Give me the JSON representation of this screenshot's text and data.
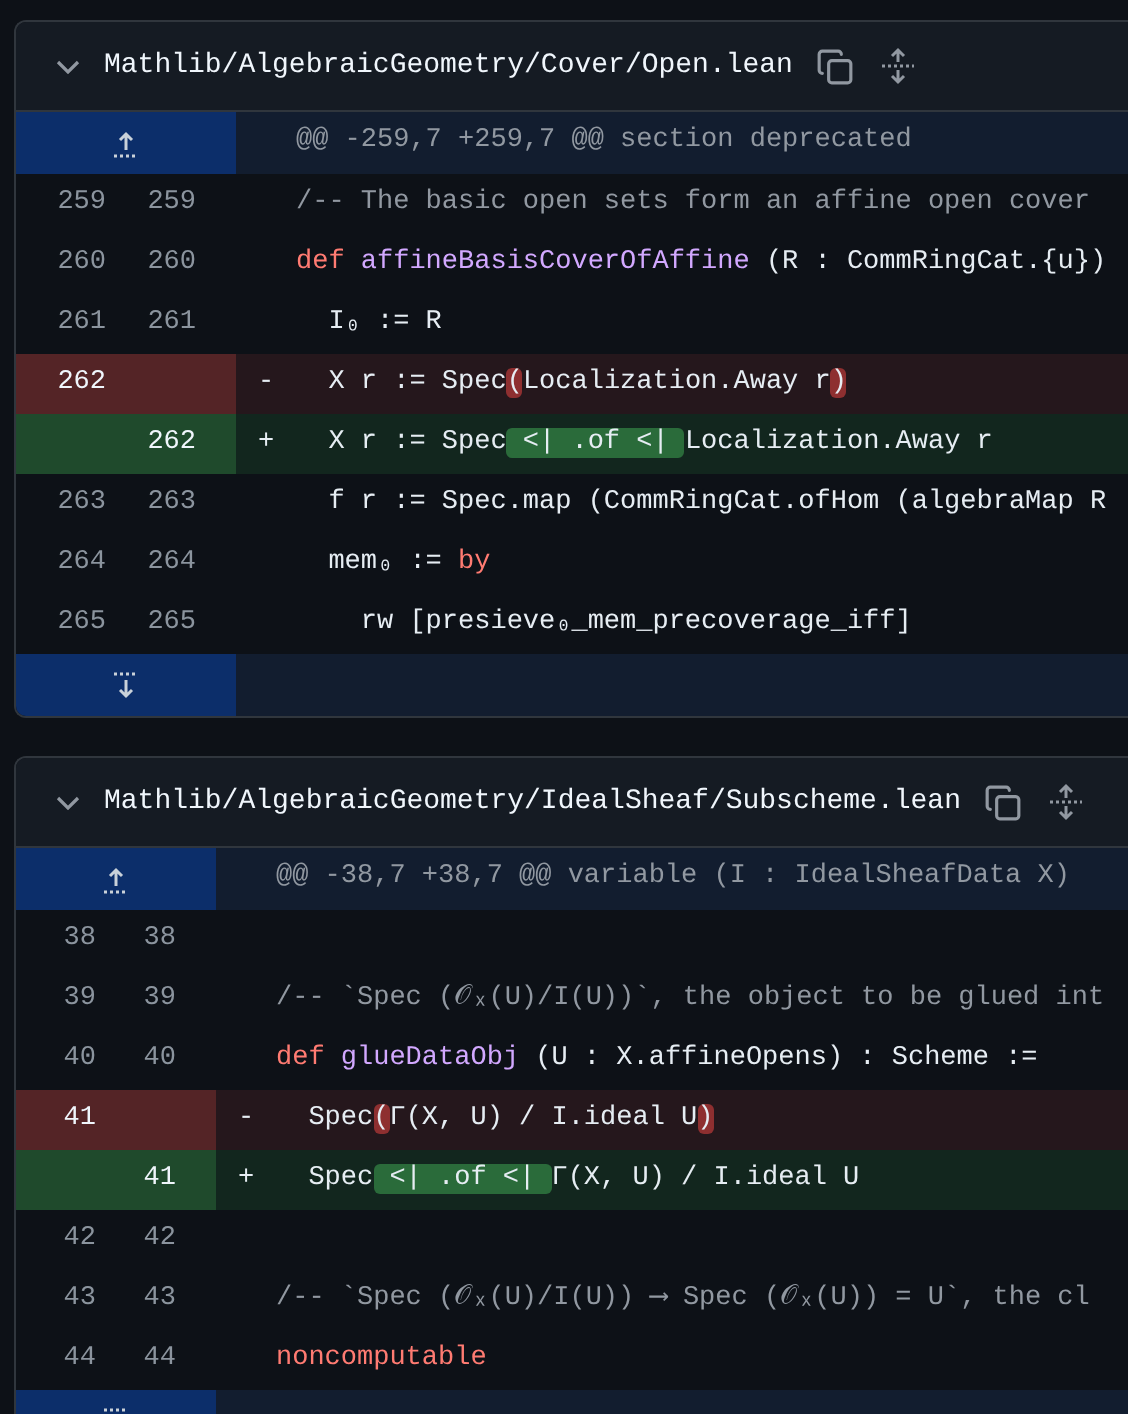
{
  "files": [
    {
      "path": "Mathlib/AlgebraicGeometry/Cover/Open.lean",
      "expanded": true,
      "hunk_header": "@@ -259,7 +259,7 @@ section deprecated",
      "bottom_expander": true,
      "lines": [
        {
          "kind": "context",
          "old": "259",
          "new": "259",
          "segments": [
            {
              "kind": "comment",
              "text": "/-- The basic open sets form an affine open cover"
            }
          ]
        },
        {
          "kind": "context",
          "old": "260",
          "new": "260",
          "segments": [
            {
              "kind": "keyword",
              "text": "def "
            },
            {
              "kind": "name",
              "text": "affineBasisCoverOfAffine"
            },
            {
              "kind": "plain",
              "text": " (R : CommRingCat.{u})"
            }
          ]
        },
        {
          "kind": "context",
          "old": "261",
          "new": "261",
          "segments": [
            {
              "kind": "plain",
              "text": "  I₀ := R"
            }
          ]
        },
        {
          "kind": "deleted",
          "old": "262",
          "sign": "-",
          "segments": [
            {
              "kind": "plain",
              "text": "  X r := Spec"
            },
            {
              "kind": "deleted_mark",
              "text": "("
            },
            {
              "kind": "plain",
              "text": "Localization.Away r"
            },
            {
              "kind": "deleted_mark",
              "text": ")"
            }
          ]
        },
        {
          "kind": "added",
          "new": "262",
          "sign": "+",
          "segments": [
            {
              "kind": "plain",
              "text": "  X r := Spec"
            },
            {
              "kind": "added_mark",
              "text": " <| .of <| "
            },
            {
              "kind": "plain",
              "text": "Localization.Away r"
            }
          ]
        },
        {
          "kind": "context",
          "old": "263",
          "new": "263",
          "segments": [
            {
              "kind": "plain",
              "text": "  f r := Spec.map (CommRingCat.ofHom (algebraMap R"
            }
          ]
        },
        {
          "kind": "context",
          "old": "264",
          "new": "264",
          "segments": [
            {
              "kind": "plain",
              "text": "  mem₀ := "
            },
            {
              "kind": "keyword",
              "text": "by"
            }
          ]
        },
        {
          "kind": "context",
          "old": "265",
          "new": "265",
          "segments": [
            {
              "kind": "plain",
              "text": "    rw [presieve₀_mem_precoverage_iff]"
            }
          ]
        }
      ]
    },
    {
      "path": "Mathlib/AlgebraicGeometry/IdealSheaf/Subscheme.lean",
      "expanded": true,
      "hunk_header": "@@ -38,7 +38,7 @@ variable (I : IdealSheafData X)",
      "bottom_expander": true,
      "lines": [
        {
          "kind": "context",
          "old": "38",
          "new": "38"
        },
        {
          "kind": "context",
          "old": "39",
          "new": "39",
          "segments": [
            {
              "kind": "comment",
              "text": "/-- `Spec (𝒪ₓ(U)/I(U))`, the object to be glued int"
            }
          ]
        },
        {
          "kind": "context",
          "old": "40",
          "new": "40",
          "segments": [
            {
              "kind": "keyword",
              "text": "def "
            },
            {
              "kind": "name",
              "text": "glueDataObj"
            },
            {
              "kind": "plain",
              "text": " (U : X.affineOpens) : Scheme :="
            }
          ]
        },
        {
          "kind": "deleted",
          "old": "41",
          "sign": "-",
          "segments": [
            {
              "kind": "plain",
              "text": "  Spec"
            },
            {
              "kind": "deleted_mark",
              "text": "("
            },
            {
              "kind": "plain",
              "text": "Γ(X, U) / I.ideal U"
            },
            {
              "kind": "deleted_mark",
              "text": ")"
            }
          ]
        },
        {
          "kind": "added",
          "new": "41",
          "sign": "+",
          "segments": [
            {
              "kind": "plain",
              "text": "  Spec"
            },
            {
              "kind": "added_mark",
              "text": " <| .of <| "
            },
            {
              "kind": "plain",
              "text": "Γ(X, U) / I.ideal U"
            }
          ]
        },
        {
          "kind": "context",
          "old": "42",
          "new": "42"
        },
        {
          "kind": "context",
          "old": "43",
          "new": "43",
          "segments": [
            {
              "kind": "comment",
              "text": "/-- `Spec (𝒪ₓ(U)/I(U)) ⟶ Spec (𝒪ₓ(U)) = U`, the cl"
            }
          ]
        },
        {
          "kind": "context",
          "old": "44",
          "new": "44",
          "segments": [
            {
              "kind": "keyword",
              "text": "noncomputable"
            }
          ]
        }
      ]
    }
  ]
}
